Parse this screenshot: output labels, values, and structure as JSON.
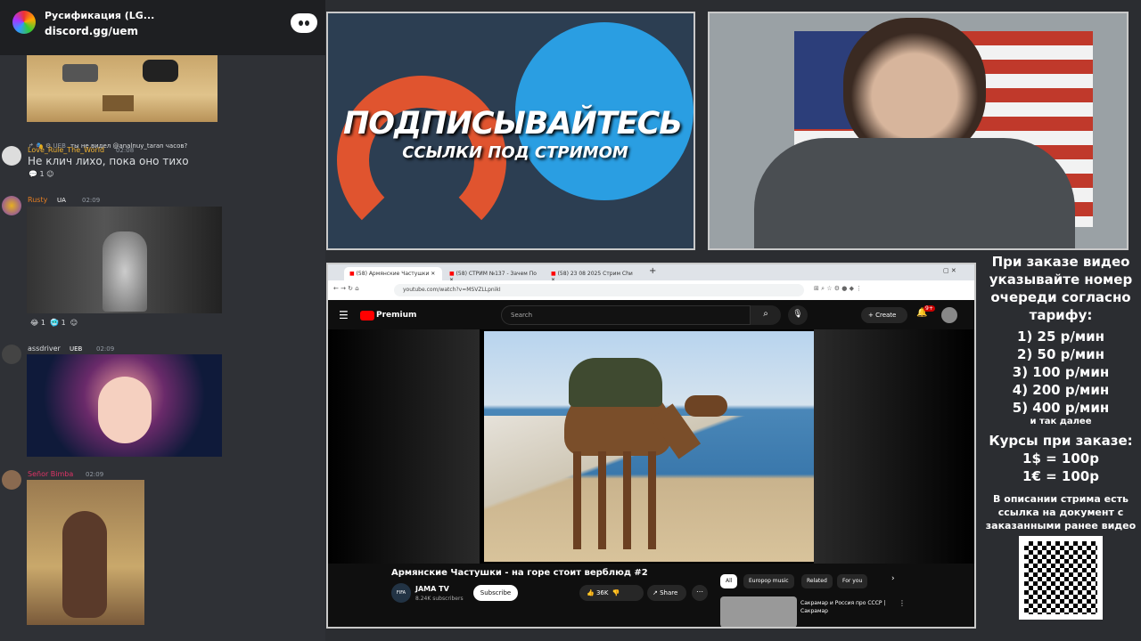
{
  "discord": {
    "server_name": "Русификация (LG...",
    "invite": "discord.gg/uem",
    "messages": [
      {
        "reply_user": "UEB",
        "reply_text": "ты не видел @analnuy_taran часов?",
        "user": "Love_Rule_The_World",
        "time": "02:08",
        "text": "Не клич лихо, пока оно тихо",
        "reactions": [
          "1"
        ]
      },
      {
        "user": "Rusty",
        "badge": "UA",
        "time": "02:09",
        "reactions": [
          "1",
          "1"
        ]
      },
      {
        "user": "assdriver",
        "badge": "UEB",
        "time": "02:09"
      },
      {
        "user": "Señor Bimba",
        "time": "02:09"
      }
    ]
  },
  "promo": {
    "line1": "ПОДПИСЫВАЙТЕСЬ",
    "line2": "ССЫЛКИ ПОД СТРИМОМ"
  },
  "browser": {
    "tabs": [
      "(58) Армянские Частушки",
      "(58) СТРИМ №137 - Зачем По",
      "(58) 23 08 2025 Стрим Сhи"
    ],
    "url": "youtube.com/watch?v=MSVZLLpnikI",
    "yt_logo": "Premium",
    "search_placeholder": "Search",
    "create_label": "Create",
    "notif_count": "9+",
    "video_title": "Армянские Частушки - на горе стоит верблюд #2",
    "channel": "JAMA TV",
    "channel_logo": "FIFA",
    "subscribers": "8.24K subscribers",
    "subscribe_label": "Subscribe",
    "likes": "36K",
    "share_label": "Share",
    "chips": [
      "All",
      "Europop music",
      "Related",
      "For you"
    ],
    "rec_title": "Сакрамар и Россия про СССР | Сакрамар"
  },
  "info": {
    "intro": "При заказе видео указывайте номер очереди согласно тарифу:",
    "tariffs": [
      "1) 25 р/мин",
      "2) 50 р/мин",
      "3) 100 р/мин",
      "4) 200 р/мин",
      "5) 400 р/мин"
    ],
    "etc": "и так далее",
    "rates_title": "Курсы при заказе:",
    "rates": [
      "1$ = 100р",
      "1€ = 100р"
    ],
    "desc": "В описании стрима есть ссылка на документ с заказанными ранее видео"
  },
  "colors": {
    "youtube_red": "#ff0000",
    "discord_blurple": "#5865f2",
    "telegram_blue": "#2a9ee2",
    "patreon_orange": "#e0542f"
  }
}
